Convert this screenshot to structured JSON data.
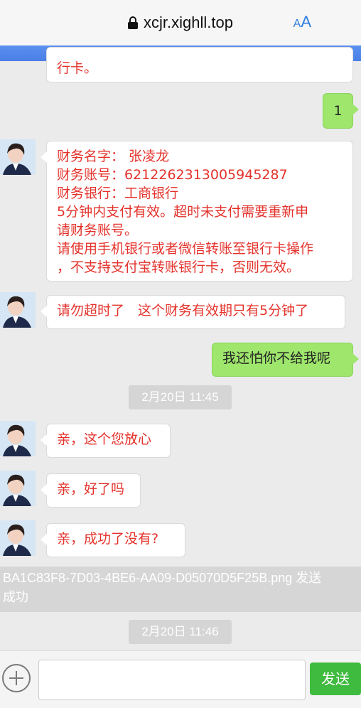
{
  "browser": {
    "url": "xcjr.xighll.top",
    "text_size_small": "A",
    "text_size_large": "A"
  },
  "messages": [
    {
      "side": "left",
      "text": "行卡。"
    },
    {
      "side": "right",
      "text": "1"
    },
    {
      "side": "left",
      "lines": [
        "财务名字： 张凌龙",
        "财务账号：6212262313005945287",
        "财务银行：工商银行",
        "5分钟内支付有效。超时未支付需要重新申",
        "请财务账号。",
        "请使用手机银行或者微信转账至银行卡操作",
        "，不支持支付宝转账银行卡，否则无效。"
      ]
    },
    {
      "side": "left",
      "text": "请勿超时了　这个财务有效期只有5分钟了"
    },
    {
      "side": "right",
      "text": "我还怕你不给我呢"
    },
    {
      "side": "left",
      "text": "亲，这个您放心"
    },
    {
      "side": "left",
      "text": "亲，好了吗"
    },
    {
      "side": "left",
      "text": "亲，成功了没有?"
    }
  ],
  "timestamps": [
    "2月20日 11:45",
    "2月20日 11:46"
  ],
  "notice": {
    "line1": "BA1C83F8-7D03-4BE6-AA09-D05070D5F25B.png 发送",
    "line2": "成功"
  },
  "composer": {
    "send_label": "发送",
    "input_value": ""
  },
  "colors": {
    "agent_text": "#e4322b",
    "user_bubble": "#9ee66c",
    "send_button": "#3fbb3f"
  }
}
